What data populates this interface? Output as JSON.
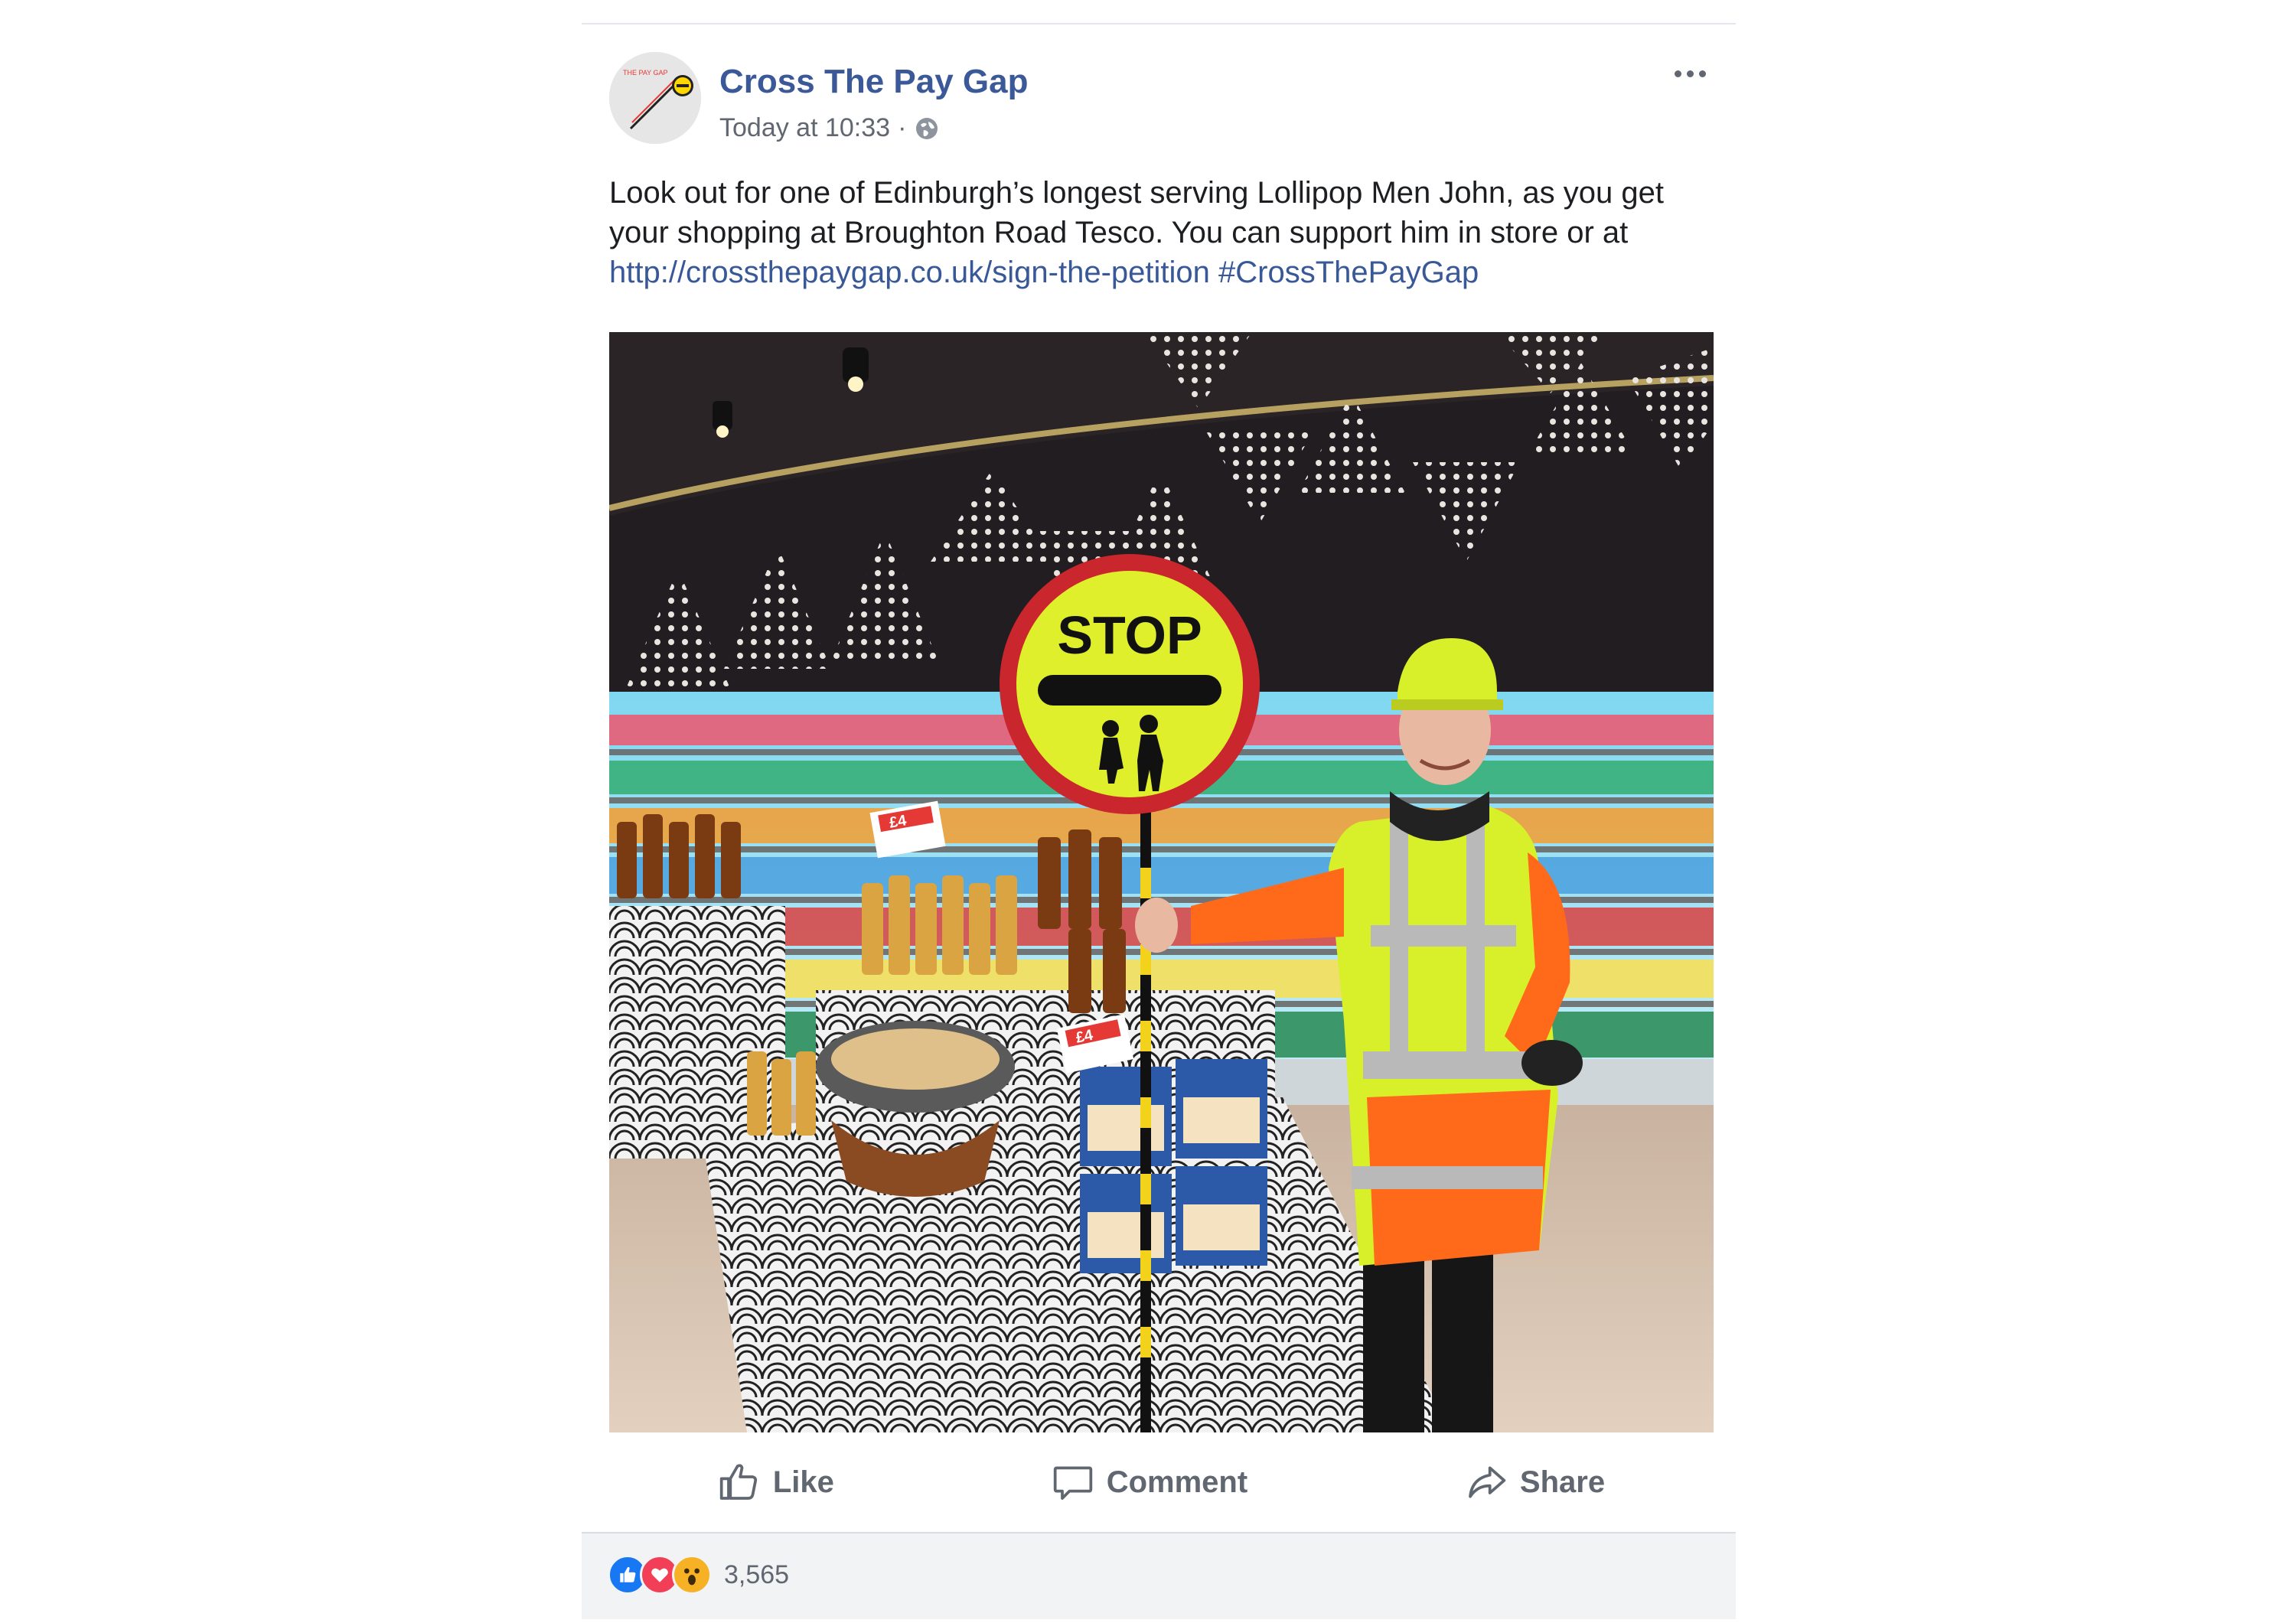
{
  "post": {
    "page_name": "Cross The Pay Gap",
    "timestamp": "Today at 10:33",
    "separator": "·",
    "privacy_icon": "globe-icon",
    "avatar_text": "THE PAY GAP",
    "text_before_link": "Look out for one of Edinburgh’s longest serving Lollipop Men John, as you get your shopping at Broughton Road Tesco. You can support him in store or at ",
    "link": "http://crossthepaygap.co.uk/sign-the-petition",
    "hashtag": "#CrossThePayGap",
    "photo": {
      "sign_text": "STOP",
      "price_tag_1": "£4",
      "price_tag_2": "£4"
    }
  },
  "actions": {
    "like_label": "Like",
    "comment_label": "Comment",
    "share_label": "Share"
  },
  "footer": {
    "reaction_count": "3,565",
    "reaction_icons": [
      "like-reaction-icon",
      "love-reaction-icon",
      "wow-reaction-icon"
    ]
  },
  "colors": {
    "brand_blue": "#3b5998",
    "link_blue": "#385898",
    "like_blue": "#1877f2",
    "love_red": "#f33e58",
    "wow_yellow": "#f7b125"
  }
}
